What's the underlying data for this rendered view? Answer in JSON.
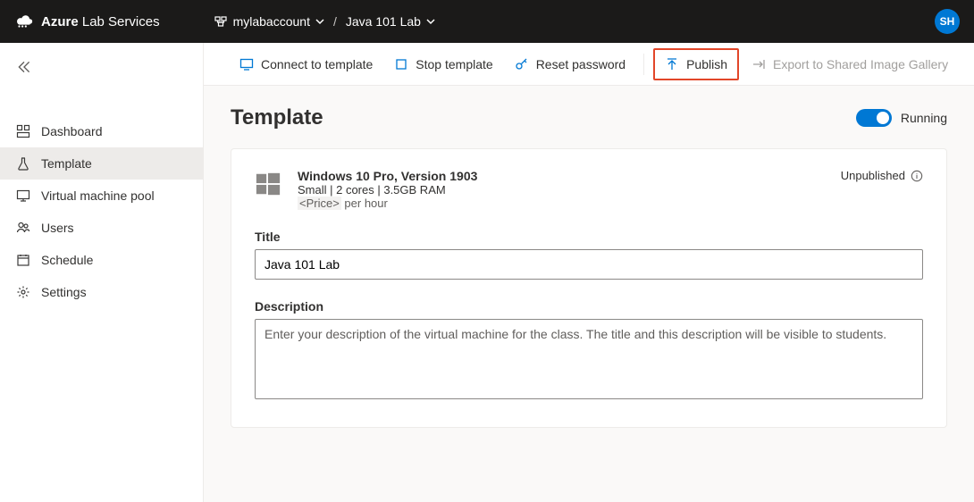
{
  "header": {
    "brand_bold": "Azure",
    "brand_rest": " Lab Services",
    "account": "mylabaccount",
    "lab": "Java 101 Lab",
    "avatar_initials": "SH"
  },
  "sidebar": {
    "items": [
      {
        "label": "Dashboard"
      },
      {
        "label": "Template"
      },
      {
        "label": "Virtual machine pool"
      },
      {
        "label": "Users"
      },
      {
        "label": "Schedule"
      },
      {
        "label": "Settings"
      }
    ],
    "active_index": 1
  },
  "toolbar": {
    "connect": "Connect to template",
    "stop": "Stop template",
    "reset": "Reset password",
    "publish": "Publish",
    "export": "Export to Shared Image Gallery"
  },
  "page": {
    "title": "Template",
    "toggle_label": "Running",
    "toggle_on": true
  },
  "template_card": {
    "os_title": "Windows 10 Pro, Version 1903",
    "spec": "Small | 2 cores | 3.5GB RAM",
    "price_tag": "<Price>",
    "price_suffix": " per hour",
    "status": "Unpublished",
    "title_label": "Title",
    "title_value": "Java 101 Lab",
    "desc_label": "Description",
    "desc_value": "",
    "desc_placeholder": "Enter your description of the virtual machine for the class. The title and this description will be visible to students."
  }
}
